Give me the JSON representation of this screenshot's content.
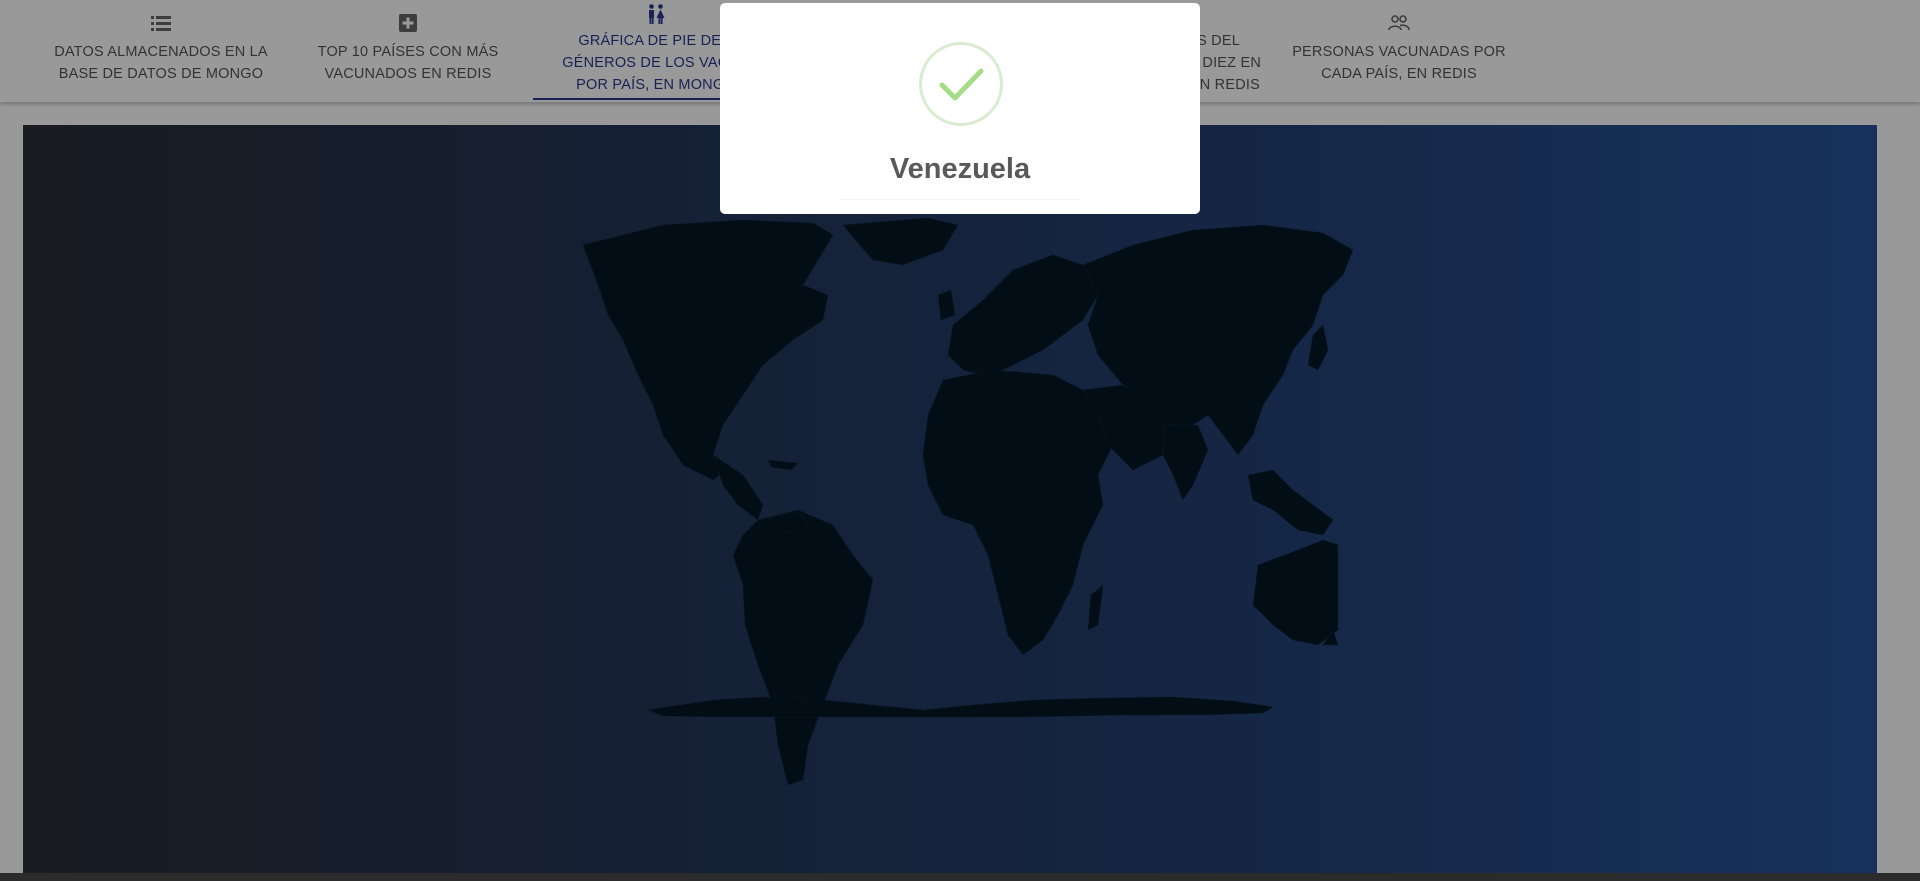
{
  "tabs": [
    {
      "label_line1": "DATOS ALMACENADOS EN LA",
      "label_line2": "BASE DE DATOS DE MONGO",
      "label_line3": "",
      "icon": "list-icon",
      "active": false
    },
    {
      "label_line1": "TOP 10 PAÍSES CON MÁS",
      "label_line2": "VACUNADOS EN REDIS",
      "label_line3": "",
      "icon": "plus-square-icon",
      "active": false
    },
    {
      "label_line1": "GRÁFICA DE PIE DE L",
      "label_line2": "GÉNEROS DE LOS VACUN",
      "label_line3": "POR PAÍS, EN MONGO",
      "icon": "gender-icon",
      "active": true
    },
    {
      "label_line1": "S DEL",
      "label_line2": "E DIEZ EN",
      "label_line3": "EN REDIS",
      "icon": "",
      "active": false
    },
    {
      "label_line1": "PERSONAS VACUNADAS POR",
      "label_line2": "CADA PAÍS, EN REDIS",
      "label_line3": "",
      "icon": "people-icon",
      "active": false
    }
  ],
  "modal": {
    "icon": "success-check-icon",
    "title": "Venezuela"
  },
  "colors": {
    "active_tab": "#2b3a8f",
    "map_land": "#041626",
    "check": "#a5dc86"
  }
}
